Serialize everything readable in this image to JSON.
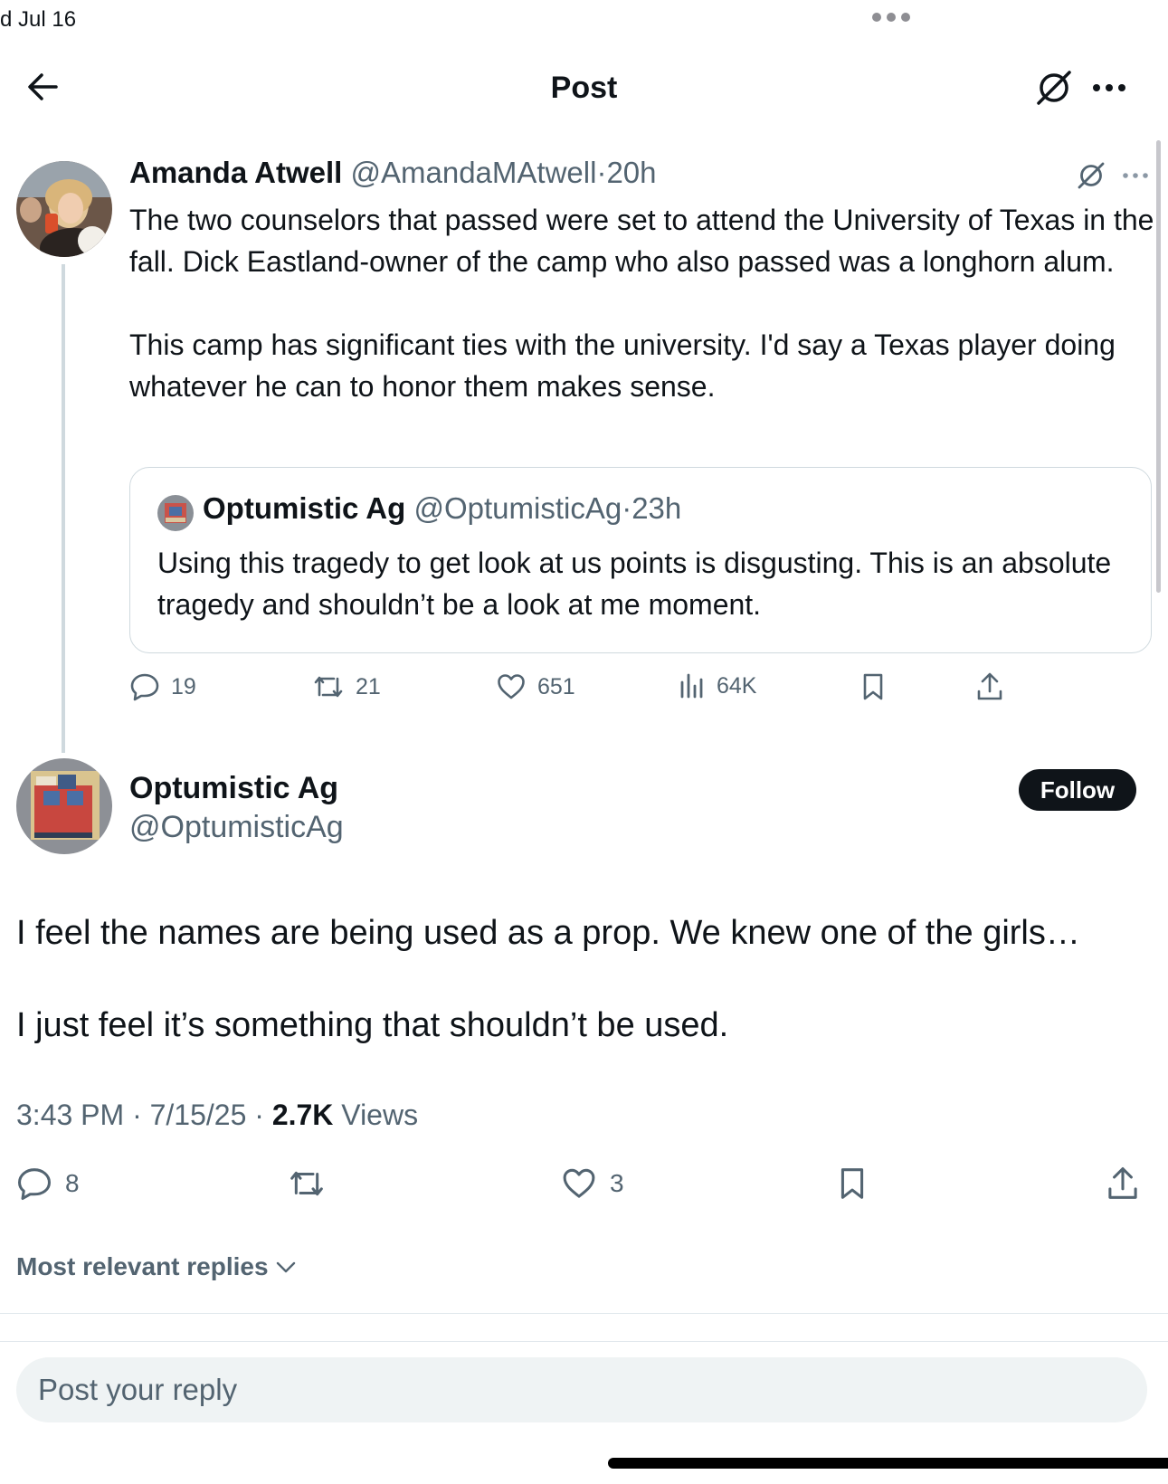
{
  "status_bar": {
    "date": "d Jul 16"
  },
  "header": {
    "title": "Post"
  },
  "parent_tweet": {
    "name": "Amanda Atwell",
    "handle": "@AmandaMAtwell",
    "separator": "·",
    "time": "20h",
    "paragraphs": [
      "The two counselors that passed were set to attend the University of Texas in the fall. Dick Eastland-owner of the camp who also passed was a longhorn alum.",
      "This camp has significant ties with the university. I'd say a Texas player doing whatever he can to honor them makes sense."
    ],
    "quote": {
      "name": "Optumistic Ag",
      "handle": "@OptumisticAg",
      "separator": "·",
      "time": "23h",
      "text": "Using this tragedy to get look at us points is disgusting. This is an absolute tragedy and shouldn’t be a look at me moment."
    },
    "actions": {
      "replies": "19",
      "reposts": "21",
      "likes": "651",
      "views": "64K"
    }
  },
  "main_tweet": {
    "name": "Optumistic Ag",
    "handle": "@OptumisticAg",
    "follow_label": "Follow",
    "paragraphs": [
      "I feel the names are being used as a prop. We knew one of the girls…",
      "I just feel it’s something that shouldn’t be used."
    ],
    "time": "3:43 PM",
    "date": "7/15/25",
    "separator": "·",
    "views_count": "2.7K",
    "views_label": "Views",
    "actions": {
      "replies": "8",
      "likes": "3"
    }
  },
  "replies_sort": {
    "label": "Most relevant replies"
  },
  "reply_box": {
    "placeholder": "Post your reply"
  },
  "colors": {
    "text": "#0f1419",
    "secondary": "#536471",
    "border": "#cfd9de",
    "input_bg": "#eff3f4"
  }
}
